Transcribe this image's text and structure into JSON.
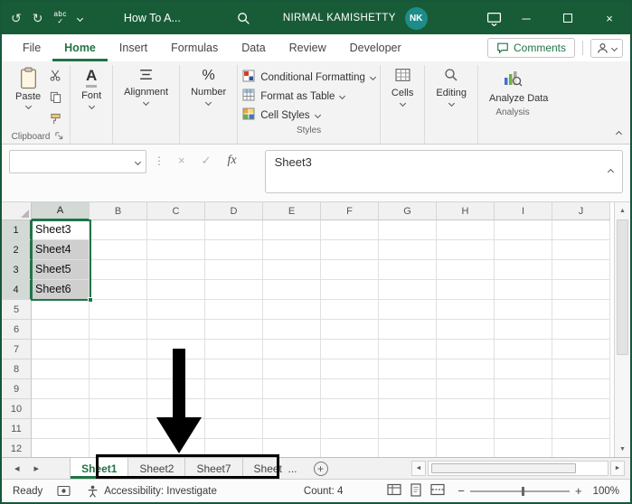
{
  "colors": {
    "titlebar_bg": "#185C37",
    "accent_green": "#217346",
    "avatar_teal": "#1E8C89",
    "selection_fill": "#CFCFCF",
    "annotation_color": "#000000"
  },
  "icons": {
    "undo": "↺",
    "redo": "↻",
    "check": "✓",
    "cancel_x": "×",
    "minimize": "─",
    "close": "×",
    "dots_splitter": "⋮",
    "up_triangle": "▲",
    "down_triangle": "▼",
    "tab_left": "◂",
    "tab_right": "▸",
    "hscroll_left": "◄",
    "hscroll_right": "►",
    "minus": "−",
    "plus": "+",
    "font_glyph": "A",
    "percent": "%"
  },
  "title_bar": {
    "spell_icon_text": "abc",
    "title": "How To A...",
    "user_name": "NIRMAL KAMISHETTY",
    "avatar_initials": "NK"
  },
  "menu": {
    "tabs": [
      {
        "label": "File",
        "active": false
      },
      {
        "label": "Home",
        "active": true
      },
      {
        "label": "Insert",
        "active": false
      },
      {
        "label": "Formulas",
        "active": false
      },
      {
        "label": "Data",
        "active": false
      },
      {
        "label": "Review",
        "active": false
      },
      {
        "label": "Developer",
        "active": false
      }
    ],
    "comments_label": "Comments"
  },
  "ribbon": {
    "paste": "Paste",
    "font": "Font",
    "alignment": "Alignment",
    "number": "Number",
    "styles_buttons": [
      "Conditional Formatting",
      "Format as Table",
      "Cell Styles"
    ],
    "cells": "Cells",
    "editing": "Editing",
    "analyze_data": "Analyze Data",
    "group_labels": {
      "clipboard": "Clipboard",
      "styles": "Styles",
      "analysis": "Analysis"
    }
  },
  "formula_bar": {
    "name_box_value": "",
    "fx_label": "fx",
    "formula_value": "Sheet3"
  },
  "grid": {
    "columns": [
      "A",
      "B",
      "C",
      "D",
      "E",
      "F",
      "G",
      "H",
      "I",
      "J"
    ],
    "row_count": 12,
    "cell_values": {
      "A1": "Sheet3",
      "A2": "Sheet4",
      "A3": "Sheet5",
      "A4": "Sheet6"
    },
    "selected_cells": [
      "A1",
      "A2",
      "A3",
      "A4"
    ],
    "active_cell": "A1",
    "selected_columns": [
      "A"
    ],
    "selected_rows": [
      1,
      2,
      3,
      4
    ]
  },
  "sheet_tabs": {
    "tabs": [
      {
        "label": "Sheet1",
        "active": true
      },
      {
        "label": "Sheet2",
        "active": false
      },
      {
        "label": "Sheet7",
        "active": false
      },
      {
        "label": "Sheet",
        "active": false,
        "truncated": true
      }
    ],
    "overflow_ellipsis": "...",
    "add_sheet": "+"
  },
  "status_bar": {
    "mode": "Ready",
    "accessibility": "Accessibility: Investigate",
    "count": "Count: 4",
    "zoom_level": "100%"
  }
}
